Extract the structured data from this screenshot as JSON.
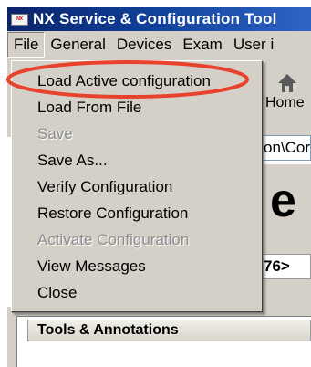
{
  "window": {
    "title": "NX Service & Configuration Tool",
    "icon": "app-logo-icon"
  },
  "menubar": {
    "items": [
      {
        "label": "File",
        "active": true
      },
      {
        "label": "General"
      },
      {
        "label": "Devices"
      },
      {
        "label": "Exam"
      },
      {
        "label": "User i"
      }
    ]
  },
  "file_menu": {
    "items": [
      {
        "label": "Load Active configuration",
        "enabled": true,
        "highlighted_by_annotation": true
      },
      {
        "label": "Load From File",
        "enabled": true
      },
      {
        "label": "Save",
        "enabled": false
      },
      {
        "label": "Save As...",
        "enabled": true
      },
      {
        "label": "Verify Configuration",
        "enabled": true
      },
      {
        "label": "Restore Configuration",
        "enabled": true
      },
      {
        "label": "Activate Configuration",
        "enabled": false
      },
      {
        "label": "View Messages",
        "enabled": true
      },
      {
        "label": "Close",
        "enabled": true
      }
    ]
  },
  "background": {
    "home_label": "Home",
    "home_icon": "home-icon",
    "path_fragment": "on\\Cor",
    "heading_fragment": "e Co",
    "id_fragment": "76>",
    "panel_title": "Tools & Annotations"
  },
  "annotation": {
    "shape": "ellipse",
    "color": "#e8412c"
  },
  "colors": {
    "titlebar": "#0a246a",
    "menu_face": "#d4d0c8",
    "disabled_text": "#8c8c8c"
  }
}
